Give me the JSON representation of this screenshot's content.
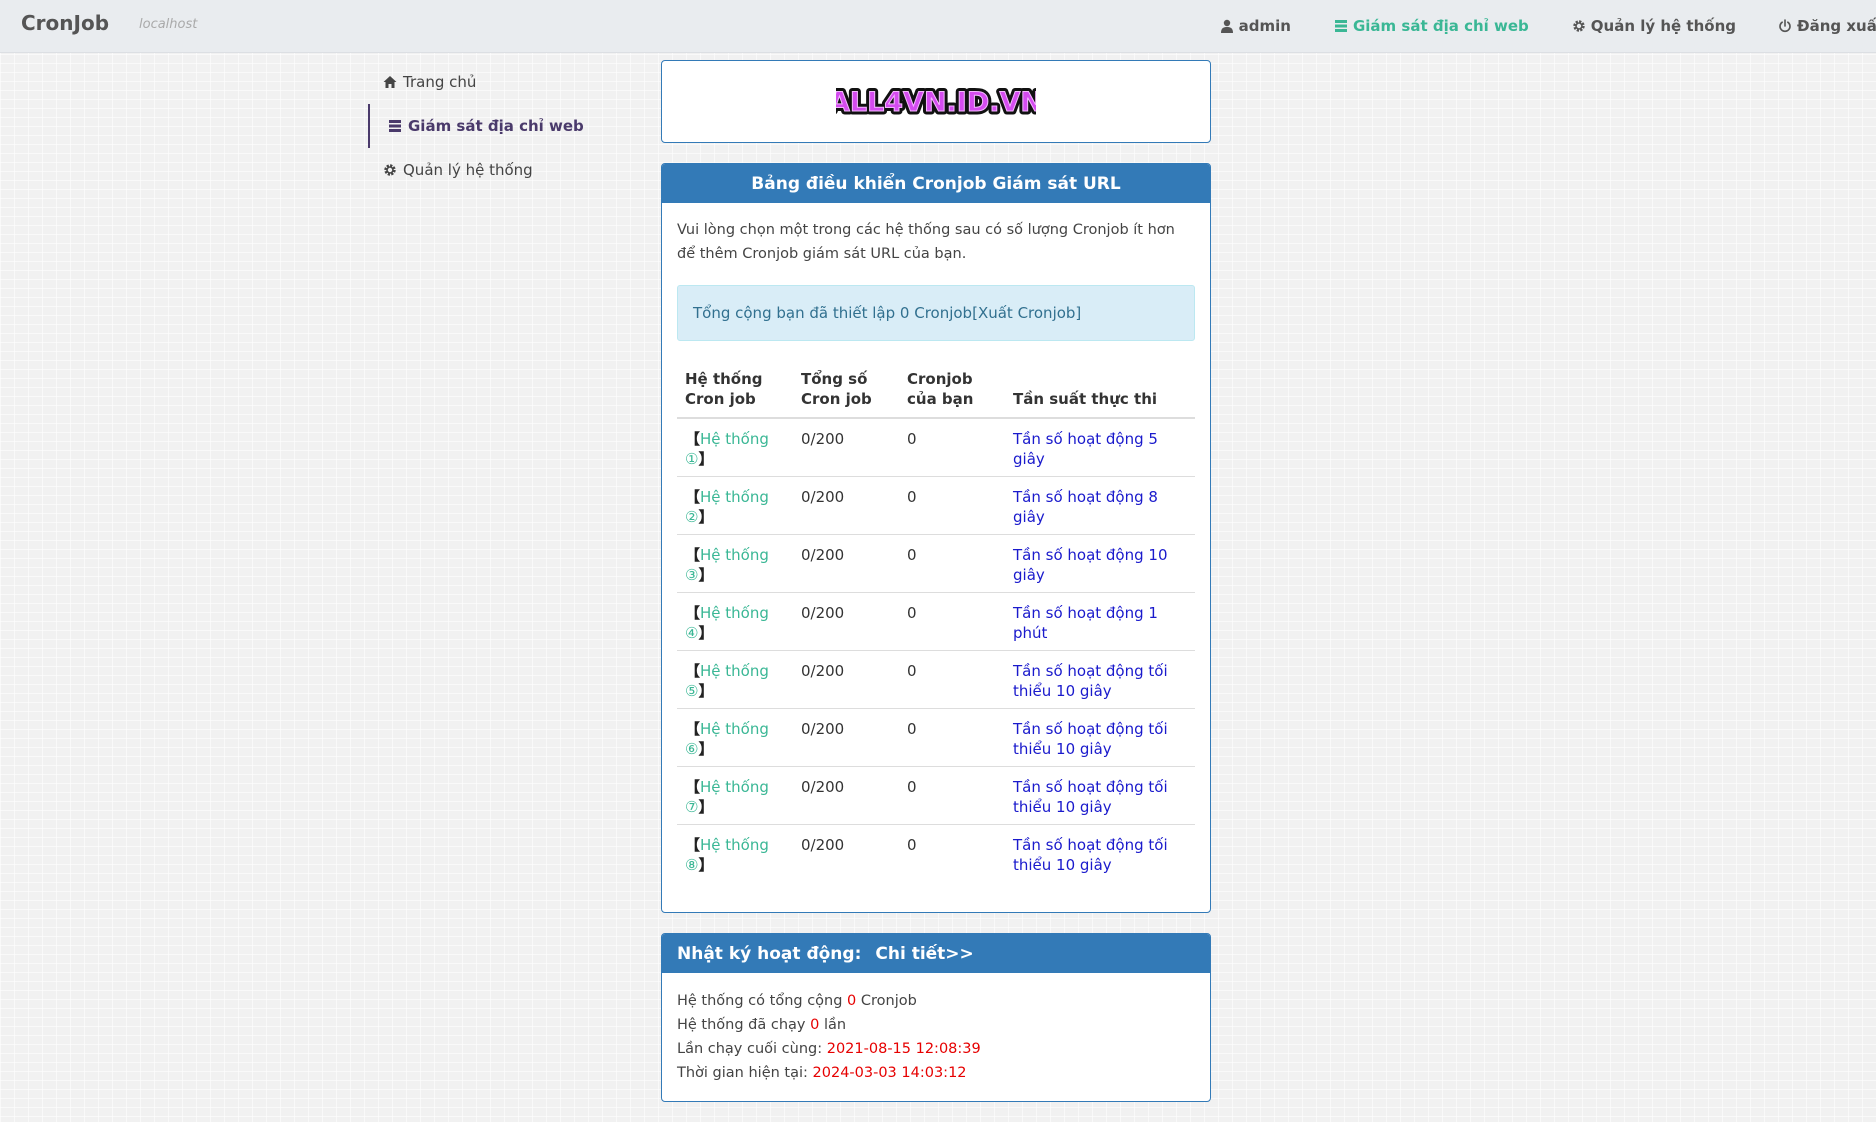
{
  "navbar": {
    "brand": "CronJob",
    "subtitle": "localhost",
    "links": {
      "admin": "admin",
      "monitor": "Giám sát địa chỉ web",
      "system": "Quản lý hệ thống",
      "logout": "Đăng xuất"
    },
    "active_color": "#3ab795"
  },
  "sidebar": {
    "items": [
      {
        "label": "Trang chủ",
        "icon": "home-icon"
      },
      {
        "label": "Giám sát địa chỉ web",
        "icon": "list-icon"
      },
      {
        "label": "Quản lý hệ thống",
        "icon": "gear-icon"
      }
    ]
  },
  "logo": {
    "text": "ALL4VN.ID.VN"
  },
  "dashboard": {
    "title": "Bảng điều khiển Cronjob Giám sát URL",
    "intro": "Vui lòng chọn một trong các hệ thống sau có số lượng Cronjob ít hơn để thêm Cronjob giám sát URL của bạn.",
    "alert_prefix": "Tổng cộng bạn đã thiết lập 0 Cronjob ",
    "alert_link": "[Xuất Cronjob]",
    "columns": [
      "Hệ thống Cron job",
      "Tổng số Cron job",
      "Cronjob của bạn",
      "Tần suất thực thi"
    ],
    "rows": [
      {
        "open": "【",
        "system": "Hệ thống ①",
        "close": "】",
        "total": "0/200",
        "mine": "0",
        "frequency": "Tần số hoạt động 5 giây"
      },
      {
        "open": "【",
        "system": "Hệ thống ②",
        "close": "】",
        "total": "0/200",
        "mine": "0",
        "frequency": "Tần số hoạt động 8 giây"
      },
      {
        "open": "【",
        "system": "Hệ thống ③",
        "close": "】",
        "total": "0/200",
        "mine": "0",
        "frequency": "Tần số hoạt động 10 giây"
      },
      {
        "open": "【",
        "system": "Hệ thống ④",
        "close": "】",
        "total": "0/200",
        "mine": "0",
        "frequency": "Tần số hoạt động 1 phút"
      },
      {
        "open": "【",
        "system": "Hệ thống ⑤",
        "close": "】",
        "total": "0/200",
        "mine": "0",
        "frequency": "Tần số hoạt động tối thiểu 10 giây"
      },
      {
        "open": "【",
        "system": "Hệ thống ⑥",
        "close": "】",
        "total": "0/200",
        "mine": "0",
        "frequency": "Tần số hoạt động tối thiểu 10 giây"
      },
      {
        "open": "【",
        "system": "Hệ thống ⑦",
        "close": "】",
        "total": "0/200",
        "mine": "0",
        "frequency": "Tần số hoạt động tối thiểu 10 giây"
      },
      {
        "open": "【",
        "system": "Hệ thống ⑧",
        "close": "】",
        "total": "0/200",
        "mine": "0",
        "frequency": "Tần số hoạt động tối thiểu 10 giây"
      }
    ]
  },
  "activity_log": {
    "title": "Nhật ký hoạt động:",
    "detail_link": "Chi tiết>>",
    "line1": {
      "prefix": "Hệ thống có tổng cộng ",
      "value": "0",
      "suffix": " Cronjob"
    },
    "line2": {
      "prefix": "Hệ thống đã chạy ",
      "value": "0",
      "suffix": " lần"
    },
    "line3": {
      "prefix": "Lần chạy cuối cùng: ",
      "value": "2021-08-15 12:08:39"
    },
    "line4": {
      "prefix": "Thời gian hiện tại: ",
      "value": "2024-03-03 14:03:12"
    }
  }
}
